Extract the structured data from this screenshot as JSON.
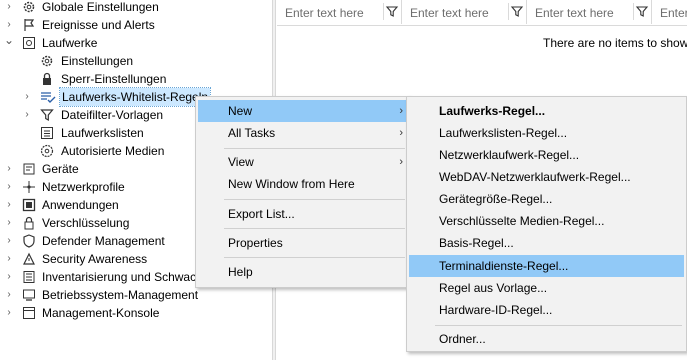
{
  "tree": {
    "items": [
      {
        "label": "Globale Einstellungen",
        "icon": "gear-icon",
        "chevron": "›"
      },
      {
        "label": "Ereignisse und Alerts",
        "icon": "flag-icon",
        "chevron": "›"
      },
      {
        "label": "Laufwerke",
        "icon": "drive-icon",
        "chevron": "⌄"
      },
      {
        "label": "Einstellungen",
        "icon": "gear-icon",
        "chevron": ""
      },
      {
        "label": "Sperr-Einstellungen",
        "icon": "lock-icon",
        "chevron": ""
      },
      {
        "label": "Laufwerks-Whitelist-Regeln",
        "icon": "checklist-icon",
        "chevron": "›"
      },
      {
        "label": "Dateifilter-Vorlagen",
        "icon": "filter-icon",
        "chevron": "›"
      },
      {
        "label": "Laufwerkslisten",
        "icon": "list-icon",
        "chevron": ""
      },
      {
        "label": "Autorisierte Medien",
        "icon": "disc-icon",
        "chevron": ""
      },
      {
        "label": "Geräte",
        "icon": "device-icon",
        "chevron": "›"
      },
      {
        "label": "Netzwerkprofile",
        "icon": "network-icon",
        "chevron": "›"
      },
      {
        "label": "Anwendungen",
        "icon": "app-icon",
        "chevron": "›"
      },
      {
        "label": "Verschlüsselung",
        "icon": "padlock-icon",
        "chevron": "›"
      },
      {
        "label": "Defender Management",
        "icon": "shield-icon",
        "chevron": "›"
      },
      {
        "label": "Security Awareness",
        "icon": "awareness-icon",
        "chevron": "›"
      },
      {
        "label": "Inventarisierung und Schwachstellen",
        "icon": "inventory-icon",
        "chevron": "›"
      },
      {
        "label": "Betriebssystem-Management",
        "icon": "os-icon",
        "chevron": "›"
      },
      {
        "label": "Management-Konsole",
        "icon": "console-icon",
        "chevron": "›"
      }
    ]
  },
  "filters": {
    "placeholder": "Enter text here"
  },
  "list": {
    "empty_text": "There are no items to show"
  },
  "context_menu": {
    "items": [
      {
        "label": "New",
        "submenu": true
      },
      {
        "label": "All Tasks",
        "submenu": true
      },
      {
        "label": "View",
        "submenu": true
      },
      {
        "label": "New Window from Here",
        "submenu": false
      },
      {
        "label": "Export List...",
        "submenu": false
      },
      {
        "label": "Properties",
        "submenu": false
      },
      {
        "label": "Help",
        "submenu": false
      }
    ],
    "arrow": "›"
  },
  "submenu": {
    "items": [
      {
        "label": "Laufwerks-Regel..."
      },
      {
        "label": "Laufwerkslisten-Regel..."
      },
      {
        "label": "Netzwerklaufwerk-Regel..."
      },
      {
        "label": "WebDAV-Netzwerklaufwerk-Regel..."
      },
      {
        "label": "Gerätegröße-Regel..."
      },
      {
        "label": "Verschlüsselte Medien-Regel..."
      },
      {
        "label": "Basis-Regel..."
      },
      {
        "label": "Terminaldienste-Regel..."
      },
      {
        "label": "Regel aus Vorlage..."
      },
      {
        "label": "Hardware-ID-Regel..."
      },
      {
        "label": "Ordner..."
      }
    ]
  },
  "colors": {
    "highlight": "#91c9f7",
    "selection": "#cce8ff",
    "menu_bg": "#f2f2f2"
  }
}
